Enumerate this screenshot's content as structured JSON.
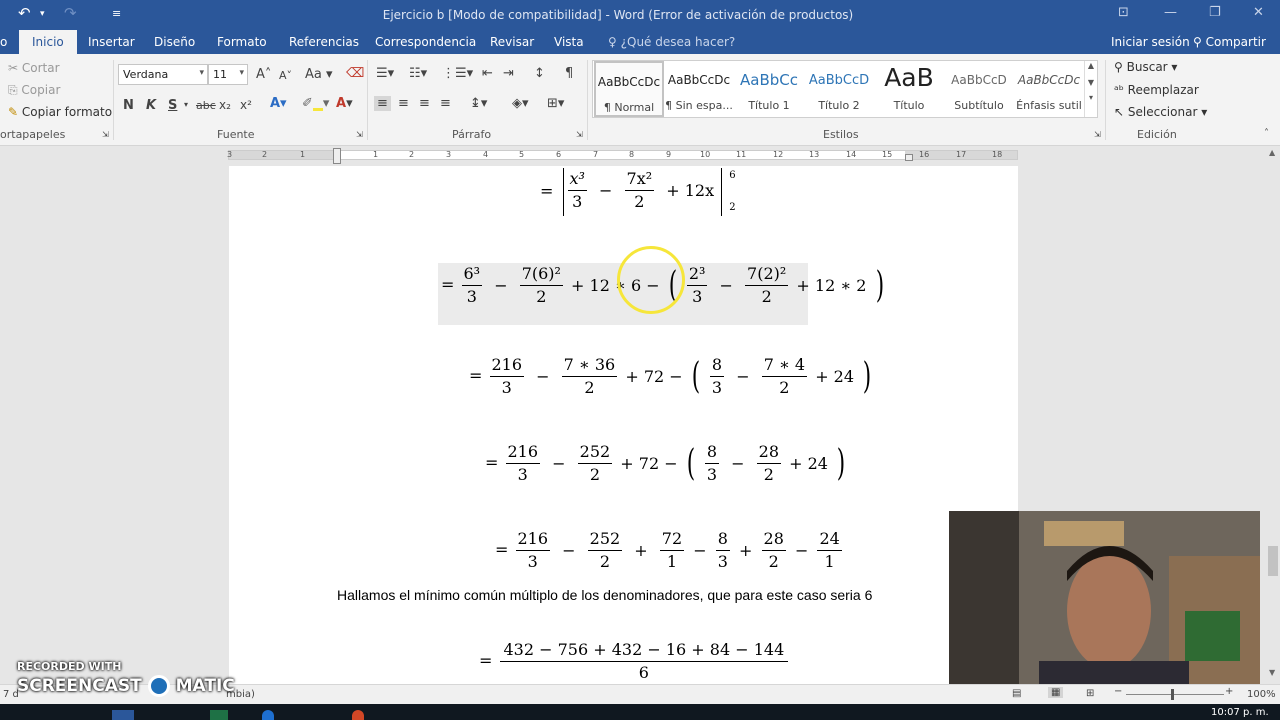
{
  "titlebar": {
    "title": "Ejercicio b [Modo de compatibilidad] - Word (Error de activación de productos)"
  },
  "tabs": [
    {
      "label": "o"
    },
    {
      "label": "Inicio"
    },
    {
      "label": "Insertar"
    },
    {
      "label": "Diseño"
    },
    {
      "label": "Formato"
    },
    {
      "label": "Referencias"
    },
    {
      "label": "Correspondencia"
    },
    {
      "label": "Revisar"
    },
    {
      "label": "Vista"
    }
  ],
  "tellme": "¿Qué desea hacer?",
  "signin": "Iniciar sesión",
  "share": "Compartir",
  "clipboard": {
    "cut": "Cortar",
    "copy": "Copiar",
    "format_painter": "Copiar formato",
    "group": "ortapapeles"
  },
  "font": {
    "name": "Verdana",
    "size": "11",
    "bold": "N",
    "italic": "K",
    "underline": "S",
    "strike": "abc",
    "sub": "x₂",
    "sup": "x²",
    "group": "Fuente",
    "grow": "A",
    "shrink": "A",
    "case": "Aa"
  },
  "paragraph": {
    "group": "Párrafo"
  },
  "styles": {
    "group": "Estilos",
    "items": [
      {
        "preview": "AaBbCcDc",
        "name": "¶ Normal"
      },
      {
        "preview": "AaBbCcDc",
        "name": "¶ Sin espa..."
      },
      {
        "preview": "AaBbCc",
        "name": "Título 1"
      },
      {
        "preview": "AaBbCcD",
        "name": "Título 2"
      },
      {
        "preview": "AaB",
        "name": "Título"
      },
      {
        "preview": "AaBbCcD",
        "name": "Subtítulo"
      },
      {
        "preview": "AaBbCcDc",
        "name": "Énfasis sutil"
      }
    ]
  },
  "editing": {
    "find": "Buscar",
    "replace": "Reemplazar",
    "select": "Seleccionar",
    "group": "Edición"
  },
  "ruler": [
    "3",
    "2",
    "1",
    "1",
    "2",
    "3",
    "4",
    "5",
    "6",
    "7",
    "8",
    "9",
    "10",
    "11",
    "12",
    "13",
    "14",
    "15",
    "16",
    "17",
    "18"
  ],
  "doc": {
    "eq1": {
      "lead": "=",
      "n1": "x³",
      "d1": "3",
      "op1": "−",
      "n2": "7x²",
      "d2": "2",
      "tail": "+ 12x",
      "upper": "6",
      "lower": "2"
    },
    "eq2": {
      "lead": "=",
      "n1": "6³",
      "d1": "3",
      "op1": "−",
      "n2": "7(6)²",
      "d2": "2",
      "mid": "+ 12 ∗ 6 −",
      "n3": "2³",
      "d3": "3",
      "op3": "−",
      "n4": "7(2)²",
      "d4": "2",
      "tail": "+ 12 ∗ 2"
    },
    "eq3": {
      "lead": "=",
      "n1": "216",
      "d1": "3",
      "op1": "−",
      "n2": "7 ∗ 36",
      "d2": "2",
      "mid": "+ 72 −",
      "n3": "8",
      "d3": "3",
      "op3": "−",
      "n4": "7 ∗ 4",
      "d4": "2",
      "tail": "+ 24"
    },
    "eq4": {
      "lead": "=",
      "n1": "216",
      "d1": "3",
      "op1": "−",
      "n2": "252",
      "d2": "2",
      "mid": "+ 72 −",
      "n3": "8",
      "d3": "3",
      "op3": "−",
      "n4": "28",
      "d4": "2",
      "tail": "+ 24"
    },
    "eq5": {
      "lead": "=",
      "n1": "216",
      "d1": "3",
      "op1": "−",
      "n2": "252",
      "d2": "2",
      "op2": "+",
      "n3": "72",
      "d3": "1",
      "op3": "−",
      "n4": "8",
      "d4": "3",
      "op4": "+",
      "n5": "28",
      "d5": "2",
      "op5": "−",
      "n6": "24",
      "d6": "1"
    },
    "sentence": "Hallamos el mínimo común múltiplo de los denominadores, que para este caso seria 6",
    "eq6": {
      "lead": "=",
      "num": "432 − 756 + 432 − 16 + 84 − 144",
      "den": "6"
    }
  },
  "status": {
    "left": "7 d",
    "lang": "mbia)",
    "zoom": "100%"
  },
  "taskbar": {
    "clock": "10:07 p. m."
  },
  "watermark": {
    "line1": "RECORDED WITH",
    "line2": "SCREENCAST",
    "line3": "MATIC"
  },
  "colors": {
    "word_blue": "#2b579a",
    "highlight": "#f6e63a"
  }
}
